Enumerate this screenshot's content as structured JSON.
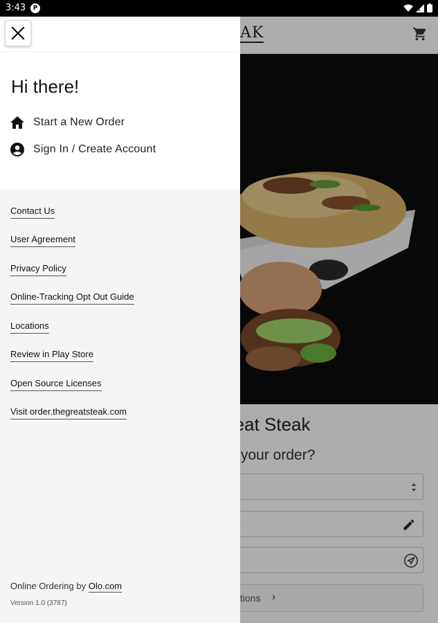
{
  "status_bar": {
    "time": "3:43",
    "notification_letter": "P"
  },
  "background": {
    "brand": "EAK",
    "title": "reat Steak",
    "subtitle": "your order?",
    "button_label": "tions",
    "button_chevron": "›"
  },
  "drawer": {
    "greeting": "Hi there!",
    "menu": [
      {
        "label": "Start a New Order",
        "icon": "home-icon"
      },
      {
        "label": "Sign In / Create Account",
        "icon": "account-circle-icon"
      }
    ],
    "links": [
      "Contact Us",
      "User Agreement",
      "Privacy Policy",
      "Online-Tracking Opt Out Guide",
      "Locations",
      "Review in Play Store",
      "Open Source Licenses",
      "Visit order.thegreatsteak.com"
    ],
    "footer": {
      "prefix": "Online Ordering by ",
      "link": "Olo.com",
      "version": "Version 1.0 (3787)"
    }
  },
  "colors": {
    "drawer_top": "#ffffff",
    "drawer_body": "#f4f5f6",
    "scrim": "rgba(0,0,0,0.32)",
    "status_bar": "#000000"
  }
}
